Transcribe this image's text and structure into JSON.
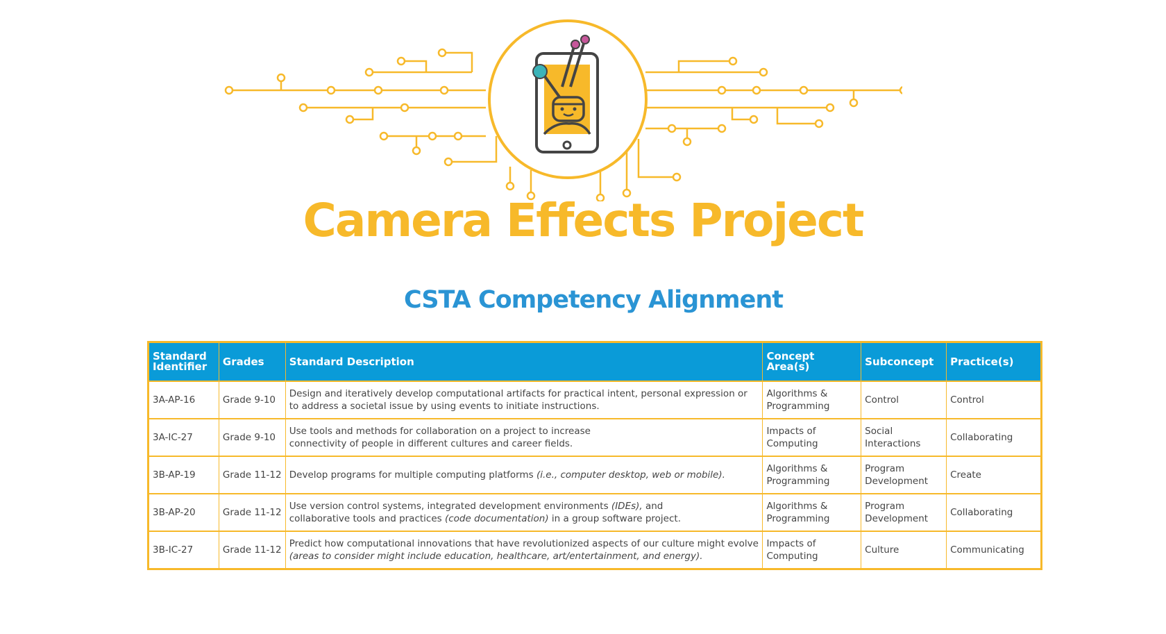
{
  "colors": {
    "brand_yellow": "#f7b92a",
    "header_blue": "#0a9bd8",
    "subtitle_blue": "#2a94d4",
    "teal": "#3bb3b8",
    "pink": "#c7579b",
    "dark": "#444444"
  },
  "logo": {
    "icon": "phone-camera-robot-icon"
  },
  "title": "Camera Effects Project",
  "subtitle": "CSTA Competency Alignment",
  "table": {
    "headers": {
      "id": "Standard Identifier",
      "grades": "Grades",
      "description": "Standard Description",
      "concept": "Concept Area(s)",
      "subconcept": "Subconcept",
      "practice": "Practice(s)"
    },
    "rows": [
      {
        "id": "3A-AP-16",
        "grade": "Grade 9-10",
        "desc": "Design and iteratively develop computational artifacts for practical intent, personal expression or to address a societal issue by using events to initiate instructions.",
        "concept": "Algorithms & Programming",
        "subconcept": "Control",
        "practice": "Control"
      },
      {
        "id": "3A-IC-27",
        "grade": "Grade 9-10",
        "desc": "Use tools and methods for collaboration on a project to increase connectivity of people in different cultures and career fields.",
        "concept": "Impacts of Computing",
        "subconcept": "Social Interactions",
        "practice": "Collaborating"
      },
      {
        "id": "3B-AP-19",
        "grade": "Grade 11-12",
        "desc_a": "Develop programs for multiple computing platforms ",
        "desc_b": "(i.e., computer desktop, web or mobile).",
        "concept": "Algorithms & Programming",
        "subconcept": "Program Development",
        "practice": "Create"
      },
      {
        "id": "3B-AP-20",
        "grade": "Grade 11-12",
        "desc_a": "Use version control systems, integrated development environments ",
        "desc_b": "(IDEs),",
        "desc_c": " and collaborative tools and practices ",
        "desc_d": "(code documentation)",
        "desc_e": " in a group software project.",
        "concept": "Algorithms & Programming",
        "subconcept": "Program Development",
        "practice": "Collaborating"
      },
      {
        "id": "3B-IC-27",
        "grade": "Grade 11-12",
        "desc_a": "Predict how computational innovations that have revolutionized aspects of our culture might evolve ",
        "desc_b": "(areas to consider might include education, healthcare, art/entertainment, and energy).",
        "concept": "Impacts of Computing",
        "subconcept": "Culture",
        "practice": "Communicating"
      }
    ]
  }
}
